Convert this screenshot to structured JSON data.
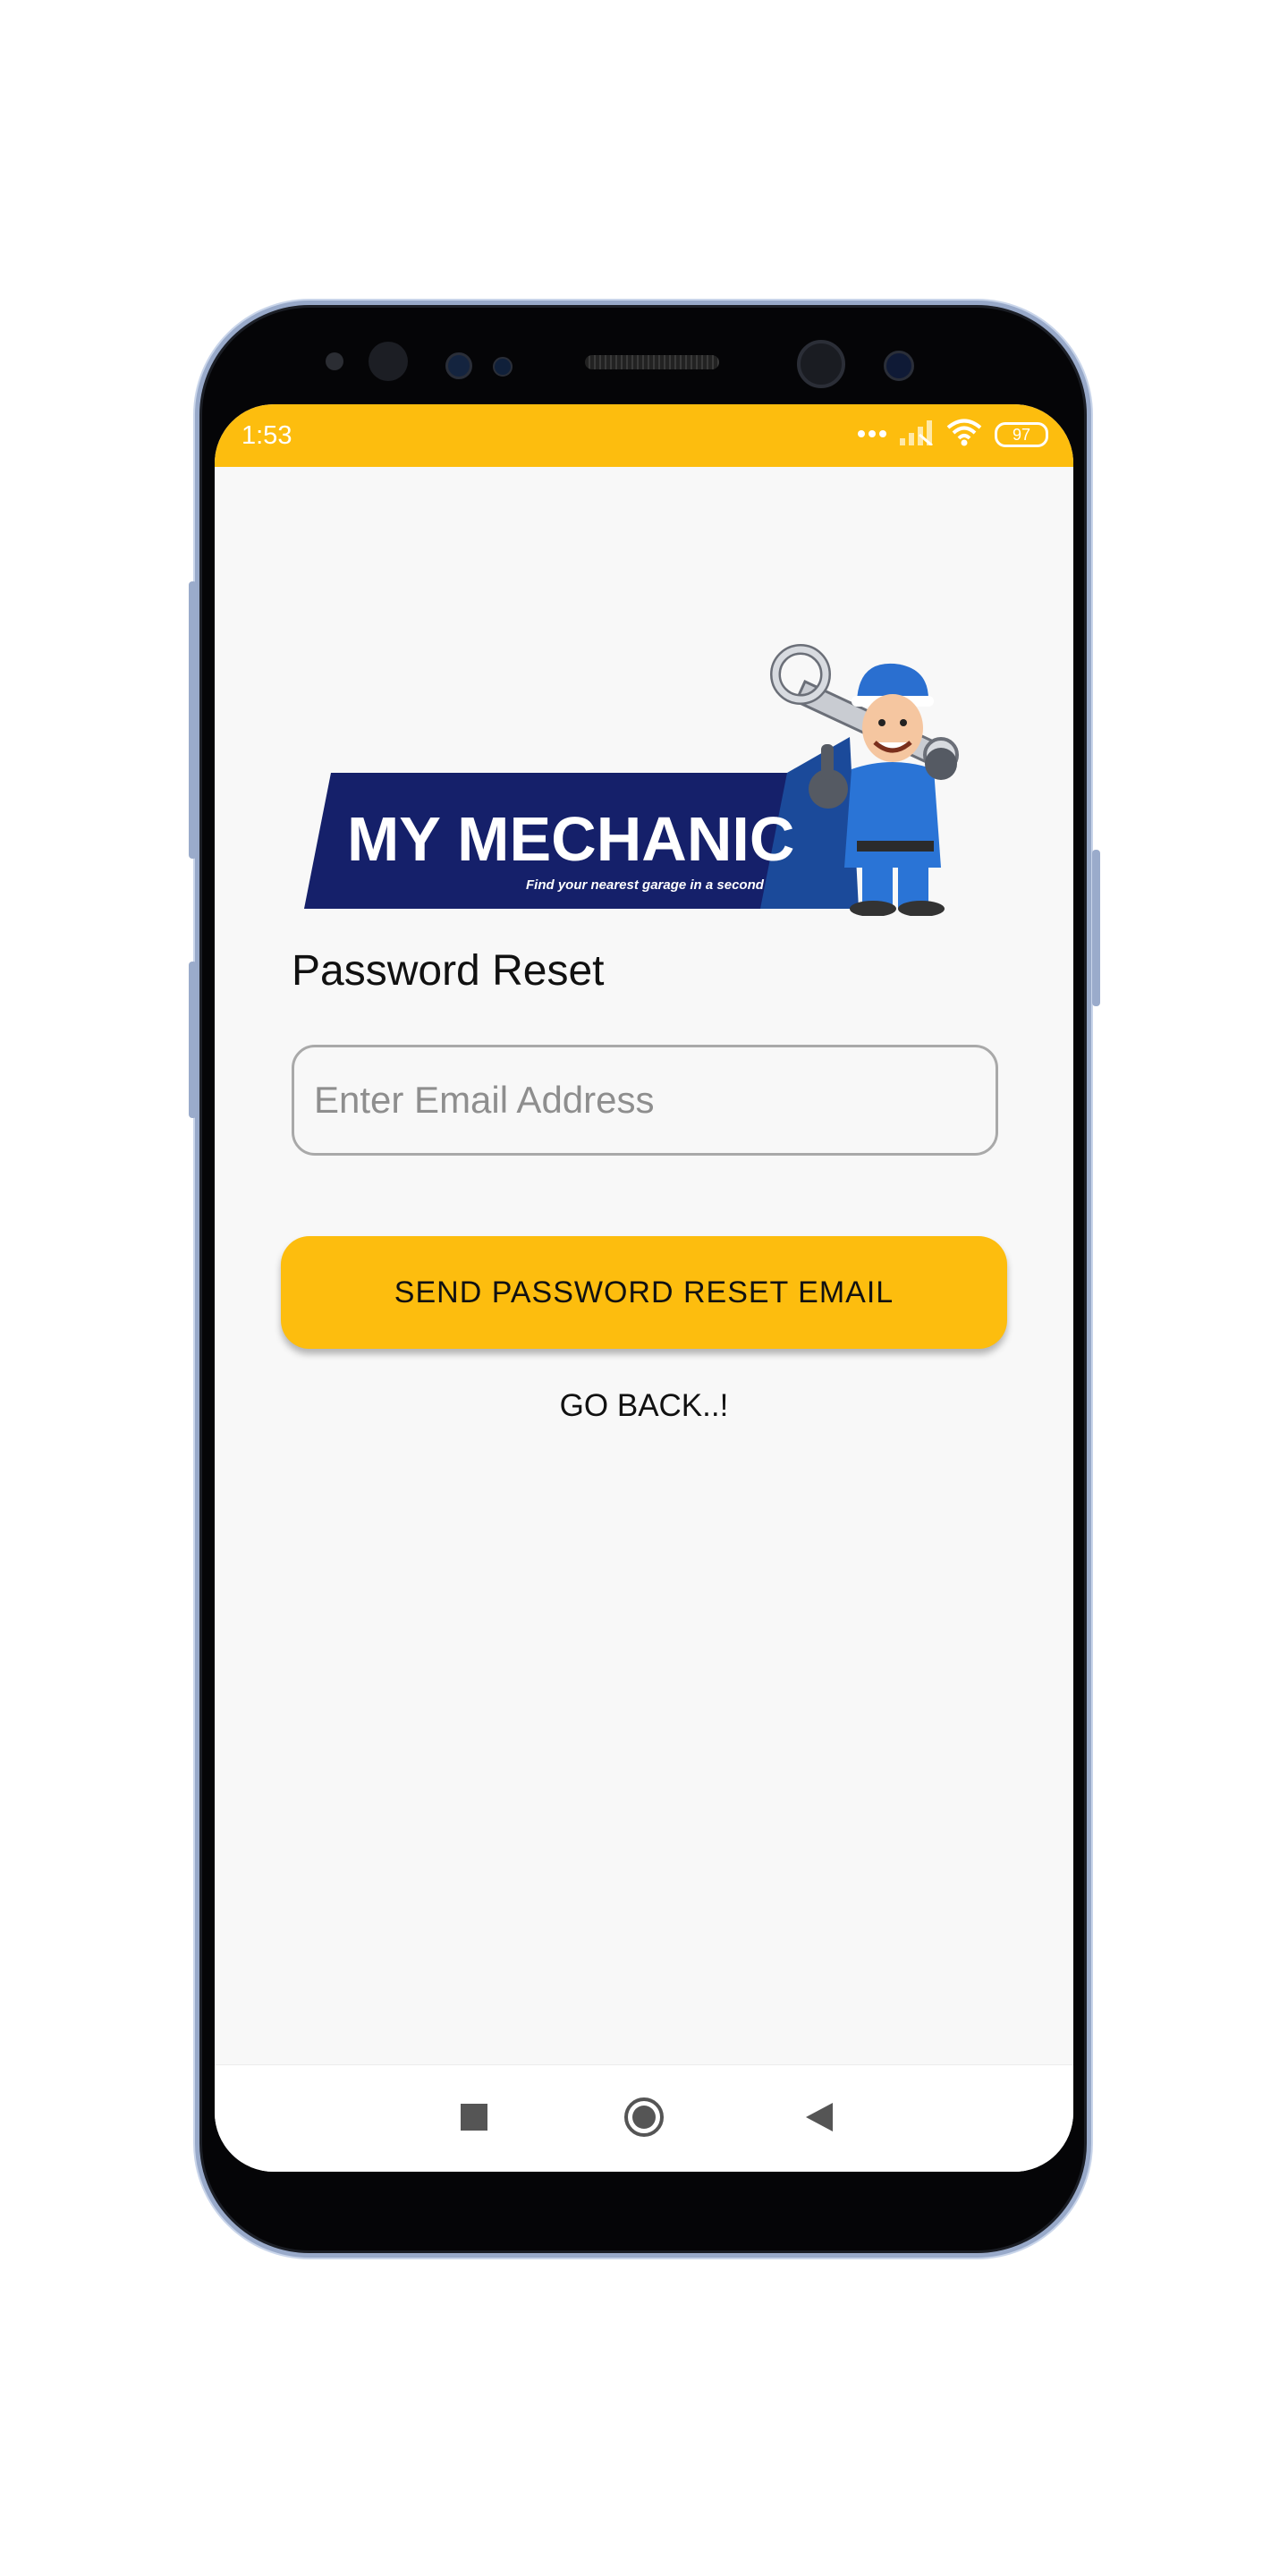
{
  "status_bar": {
    "time": "1:53",
    "battery": "97",
    "icons": [
      "dots-icon",
      "signal-icon",
      "wifi-icon",
      "battery-icon"
    ],
    "color": "#fdbd0e"
  },
  "logo": {
    "brand": "MY MECHANIC",
    "tagline": "Find your nearest garage in a second",
    "colors": {
      "banner": "#15206a",
      "accent": "#1b4a9a"
    }
  },
  "form": {
    "title": "Password Reset",
    "email_placeholder": "Enter Email Address",
    "email_value": ""
  },
  "buttons": {
    "send": "SEND PASSWORD RESET EMAIL",
    "go_back": "GO BACK..!"
  },
  "nav_bar": {
    "icons": [
      "square-icon",
      "circle-home-icon",
      "back-triangle-icon"
    ]
  },
  "theme": {
    "accent": "#fdbd0e",
    "background": "#f8f8f8"
  }
}
